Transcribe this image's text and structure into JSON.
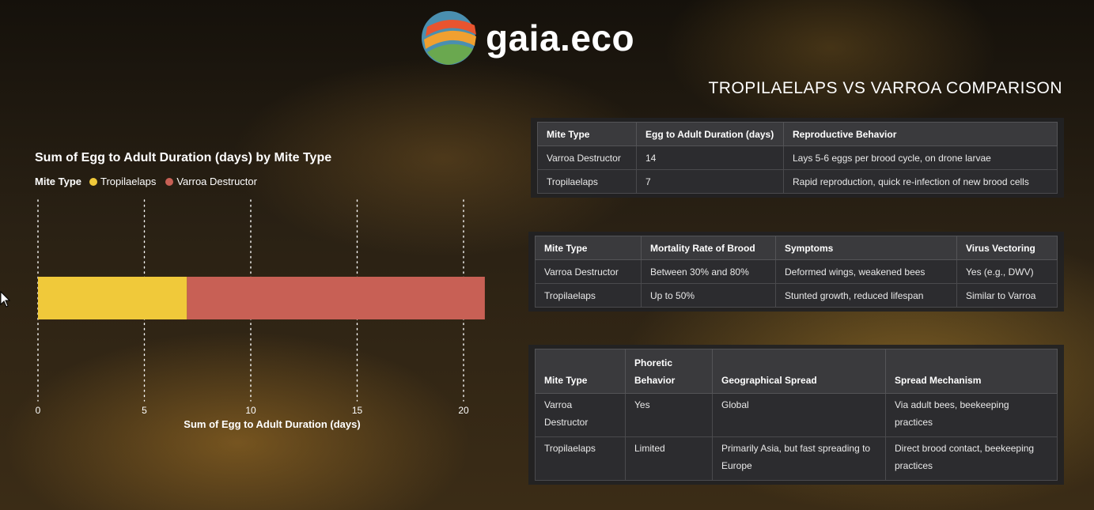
{
  "brand": {
    "name": "gaia.eco"
  },
  "page_title": "TROPILAELAPS VS VARROA COMPARISON",
  "colors": {
    "tropilaelaps": "#f0c93a",
    "varroa": "#c86055"
  },
  "chart_data": {
    "type": "bar",
    "orientation": "horizontal",
    "stacked": true,
    "title": "Sum of Egg to Adult Duration (days) by Mite Type",
    "legend_title": "Mite Type",
    "legend_position": "top-left",
    "xlabel": "Sum of Egg to Adult Duration (days)",
    "xlim": [
      0,
      21
    ],
    "xticks": [
      0,
      5,
      10,
      15,
      20
    ],
    "grid": true,
    "series": [
      {
        "name": "Tropilaelaps",
        "values": [
          7
        ],
        "color": "#f0c93a"
      },
      {
        "name": "Varroa Destructor",
        "values": [
          14
        ],
        "color": "#c86055"
      }
    ]
  },
  "table1": {
    "headers": [
      "Mite Type",
      "Egg to Adult Duration (days)",
      "Reproductive Behavior"
    ],
    "rows": [
      [
        "Varroa Destructor",
        "14",
        "Lays 5-6 eggs per brood cycle, on drone larvae"
      ],
      [
        "Tropilaelaps",
        "7",
        "Rapid reproduction, quick re-infection of new brood cells"
      ]
    ]
  },
  "table2": {
    "headers": [
      "Mite Type",
      "Mortality Rate of Brood",
      "Symptoms",
      "Virus Vectoring"
    ],
    "rows": [
      [
        "Varroa Destructor",
        "Between 30% and 80%",
        "Deformed wings, weakened bees",
        "Yes (e.g., DWV)"
      ],
      [
        "Tropilaelaps",
        "Up to 50%",
        "Stunted growth, reduced lifespan",
        "Similar to Varroa"
      ]
    ]
  },
  "table3": {
    "headers": [
      "Mite Type",
      "Phoretic Behavior",
      "Geographical Spread",
      "Spread Mechanism"
    ],
    "rows": [
      [
        "Varroa Destructor",
        "Yes",
        "Global",
        "Via adult bees, beekeeping practices"
      ],
      [
        "Tropilaelaps",
        "Limited",
        "Primarily Asia, but fast spreading to Europe",
        "Direct brood contact, beekeeping practices"
      ]
    ]
  }
}
